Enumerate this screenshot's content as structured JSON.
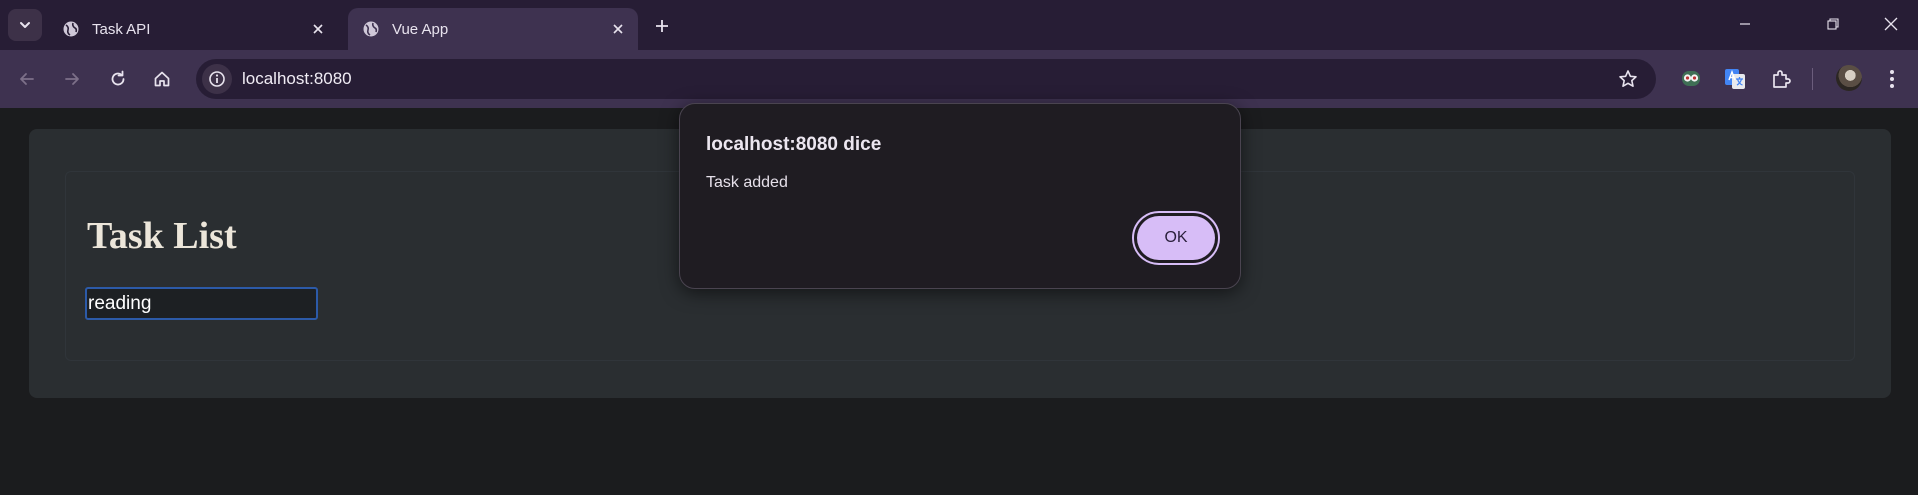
{
  "browser": {
    "tabs": [
      {
        "title": "Task API",
        "active": false
      },
      {
        "title": "Vue App",
        "active": true
      }
    ],
    "address_bar": {
      "url": "localhost:8080"
    }
  },
  "page": {
    "heading": "Task List",
    "task_input": {
      "value": "reading"
    }
  },
  "alert": {
    "title": "localhost:8080 dice",
    "message": "Task added",
    "ok_label": "OK"
  },
  "colors": {
    "tabstrip_bg": "#271d35",
    "toolbar_bg": "#3e3250",
    "page_bg": "#1b1c1e",
    "card_bg": "#2a2e31",
    "ok_button_bg": "#d7bdf7",
    "input_focus_border": "#2c5aa8"
  }
}
